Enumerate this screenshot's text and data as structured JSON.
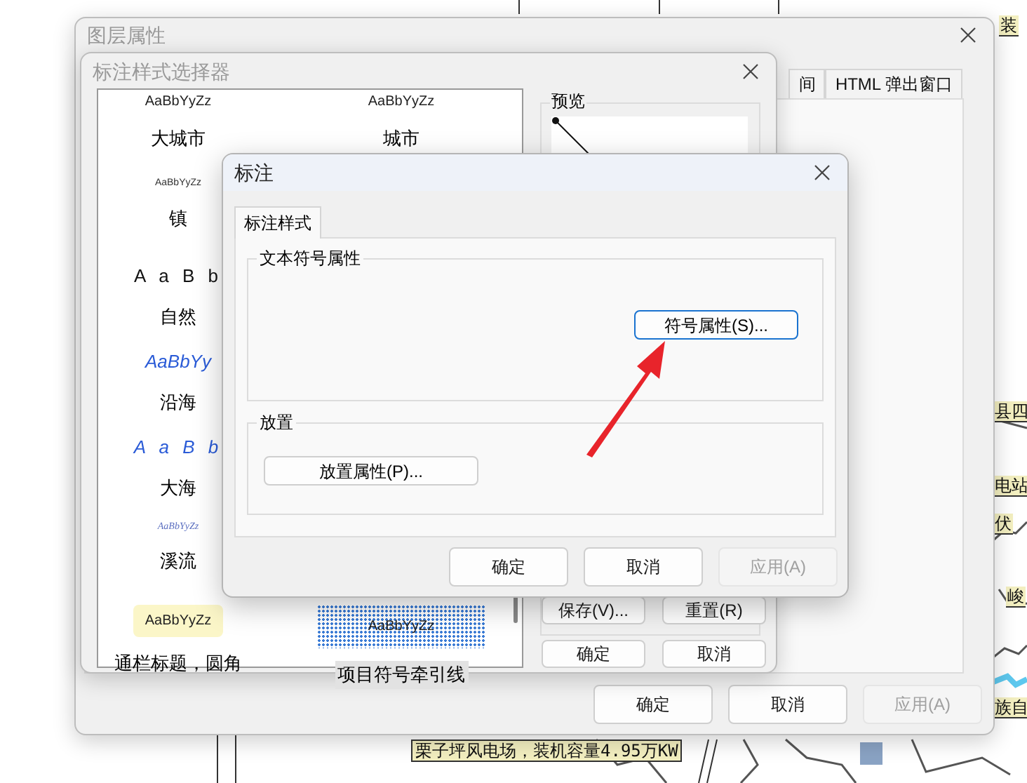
{
  "map": {
    "labels": [
      {
        "text": "装"
      },
      {
        "text": "县四"
      },
      {
        "text": "电站"
      },
      {
        "text": "伏"
      },
      {
        "text": "峻"
      },
      {
        "text": "族自"
      }
    ],
    "caption": "栗子坪风电场，装机容量4.95万KW"
  },
  "layer_window": {
    "title": "图层属性",
    "tabs": [
      {
        "label": "间",
        "selected": false
      },
      {
        "label": "HTML 弹出窗口",
        "selected": false
      }
    ],
    "buttons": [
      {
        "label": "确定",
        "disabled": false
      },
      {
        "label": "取消",
        "disabled": false
      },
      {
        "label": "应用(A)",
        "disabled": true
      }
    ]
  },
  "style_selector": {
    "title": "标注样式选择器",
    "rows": [
      {
        "cells": [
          {
            "kind": "plain",
            "sample": "AaBbYyZz",
            "name": "大城市",
            "selected": false
          },
          {
            "kind": "plain",
            "sample": "AaBbYyZz",
            "name": "城市",
            "selected": false
          }
        ]
      },
      {
        "cells": [
          {
            "kind": "small",
            "sample": "AaBbYyZz",
            "name": "镇",
            "selected": false
          }
        ]
      },
      {
        "cells": [
          {
            "kind": "spaced",
            "sample": "A a B b",
            "name": "自然",
            "selected": false
          }
        ]
      },
      {
        "cells": [
          {
            "kind": "blue-italic",
            "sample": "AaBbYy",
            "name": "沿海",
            "selected": false
          }
        ]
      },
      {
        "cells": [
          {
            "kind": "blue-spaced",
            "sample": "A a B b",
            "name": "大海",
            "selected": false
          }
        ]
      },
      {
        "cells": [
          {
            "kind": "tiny",
            "sample": "AaBbYyZz",
            "name": "溪流",
            "selected": false
          }
        ]
      },
      {
        "cells": [
          {
            "kind": "callout",
            "sample": "AaBbYyZz",
            "name": "通栏标题，圆角",
            "selected": false
          },
          {
            "kind": "leader",
            "sample": "AaBbYyZz",
            "name": "项目符号牵引线",
            "selected": true
          }
        ]
      }
    ],
    "preview_label": "预览",
    "buttons": [
      {
        "label": "保存(V)..."
      },
      {
        "label": "重置(R)"
      },
      {
        "label": "确定"
      },
      {
        "label": "取消"
      }
    ]
  },
  "label_dialog": {
    "title": "标注",
    "tabs": [
      {
        "label": "标注样式",
        "selected": true
      }
    ],
    "text_group": {
      "title": "文本符号属性",
      "button": {
        "label": "符号属性(S)...",
        "focused": true
      }
    },
    "placement_group": {
      "title": "放置",
      "button": {
        "label": "放置属性(P)...",
        "focused": false
      }
    },
    "buttons": [
      {
        "label": "确定",
        "disabled": false
      },
      {
        "label": "取消",
        "disabled": false
      },
      {
        "label": "应用(A)",
        "disabled": true
      }
    ]
  }
}
